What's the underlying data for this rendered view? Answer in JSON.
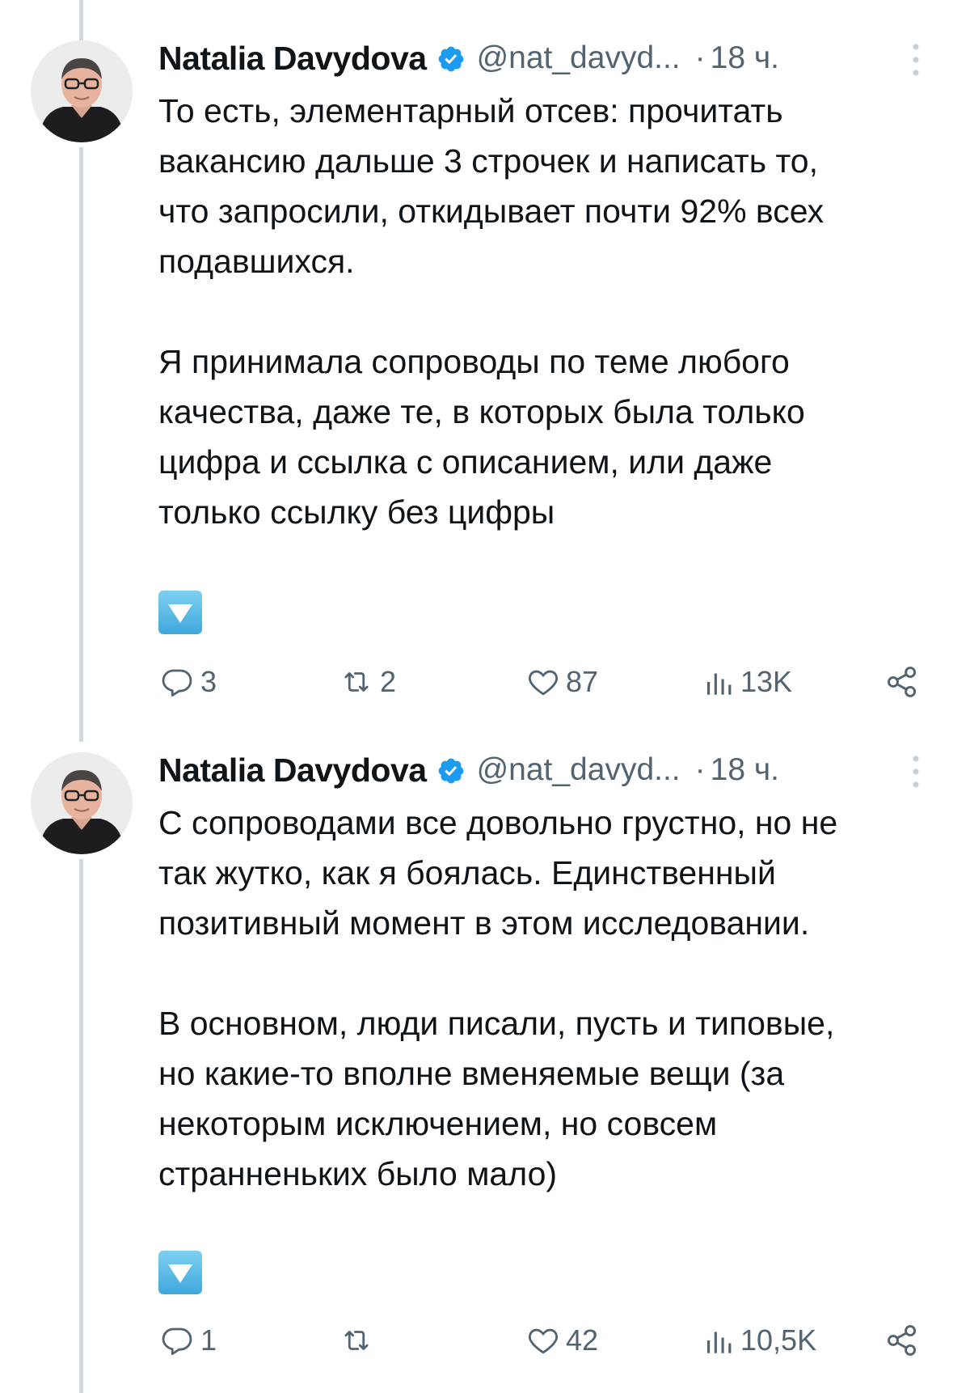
{
  "tweets": [
    {
      "author": {
        "name": "Natalia Davydova",
        "handle": "@nat_davyd...",
        "time_separator": "·",
        "time": "18 ч."
      },
      "text": "То есть, элементарный отсев: прочитать\nвакансию дальше 3 строчек и написать то,\nчто запросили, откидывает почти 92% всех\nподавшихся.\n\nЯ принимала сопроводы по теме любого\nкачества, даже те, в которых была только\nцифра и ссылка с описанием, или даже\nтолько ссылку без цифры",
      "emoji": "down-arrow-button",
      "stats": {
        "replies": "3",
        "retweets": "2",
        "likes": "87",
        "views": "13K"
      }
    },
    {
      "author": {
        "name": "Natalia Davydova",
        "handle": "@nat_davyd...",
        "time_separator": "·",
        "time": "18 ч."
      },
      "text": "С сопроводами все довольно грустно, но не\nтак жутко, как я боялась. Единственный\nпозитивный момент в этом исследовании.\n\nВ основном, люди писали, пусть и типовые,\nно какие-то вполне вменяемые вещи (за\nнекоторым исключением, но совсем\nстранненьких было мало)",
      "emoji": "down-arrow-button",
      "stats": {
        "replies": "1",
        "retweets": "",
        "likes": "42",
        "views": "10,5K"
      }
    }
  ],
  "colors": {
    "verified": "#1d9bf0",
    "secondary_text": "#536471",
    "primary_text": "#0f1419",
    "thread_line": "#cfd9de"
  }
}
